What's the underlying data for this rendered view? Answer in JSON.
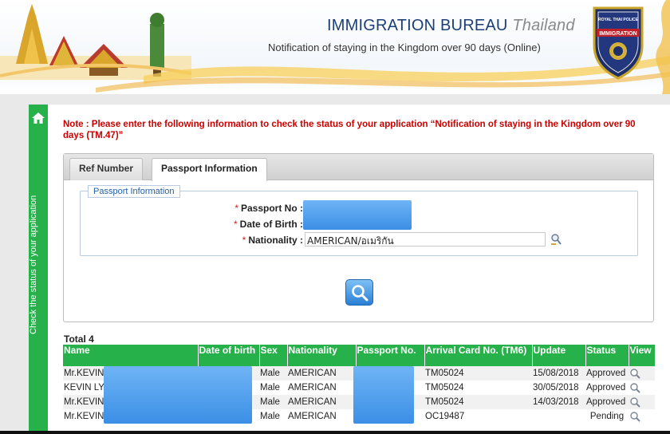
{
  "header": {
    "title_main": "IMMIGRATION BUREAU",
    "title_country": "Thailand",
    "tagline": "Notification of staying in the Kingdom over 90 days (Online)",
    "badge_top": "ROYAL THAI POLICE",
    "badge_main": "IMMIGRATION"
  },
  "sidebar": {
    "label": "Check the status of your application"
  },
  "note": "Note : Please enter the following information to check the status of your application “Notification of staying in the Kingdom over 90 days (TM.47)”",
  "tabs": [
    {
      "label": "Ref Number",
      "active": false
    },
    {
      "label": "Passport Information",
      "active": true
    }
  ],
  "form": {
    "legend": "Passport Information",
    "passport_label": "Passport No :",
    "dob_label": "Date of Birth :",
    "nationality_label": "Nationality :",
    "nationality_value": "AMERICAN/อเมริกัน",
    "required_mark": "*"
  },
  "results": {
    "total_label": "Total 4",
    "columns": [
      "Name",
      "Date of birth",
      "Sex",
      "Nationality",
      "Passport No.",
      "Arrival Card No. (TM6)",
      "Update",
      "Status",
      "View"
    ],
    "rows": [
      {
        "name": "Mr.KEVIN",
        "sex": "Male",
        "nationality": "AMERICAN",
        "tm6": "TM05024",
        "update": "15/08/2018",
        "status": "Approved"
      },
      {
        "name": "KEVIN LY",
        "sex": "Male",
        "nationality": "AMERICAN",
        "tm6": "TM05024",
        "update": "30/05/2018",
        "status": "Approved"
      },
      {
        "name": "Mr.KEVIN",
        "sex": "Male",
        "nationality": "AMERICAN",
        "tm6": "TM05024",
        "update": "14/03/2018",
        "status": "Approved"
      },
      {
        "name": "Mr.KEVIN",
        "sex": "Male",
        "nationality": "AMERICAN",
        "tm6": "OC19487",
        "update": "",
        "status": "Pending"
      }
    ]
  },
  "icons": {
    "home": "home-icon",
    "search": "search-icon",
    "lookup": "lookup-icon",
    "view": "magnifier-icon"
  },
  "colors": {
    "accent_green": "#27b14a",
    "note_red": "#cc0000",
    "title_blue": "#1d3f78",
    "redaction_blue": "#3b8fe6"
  }
}
